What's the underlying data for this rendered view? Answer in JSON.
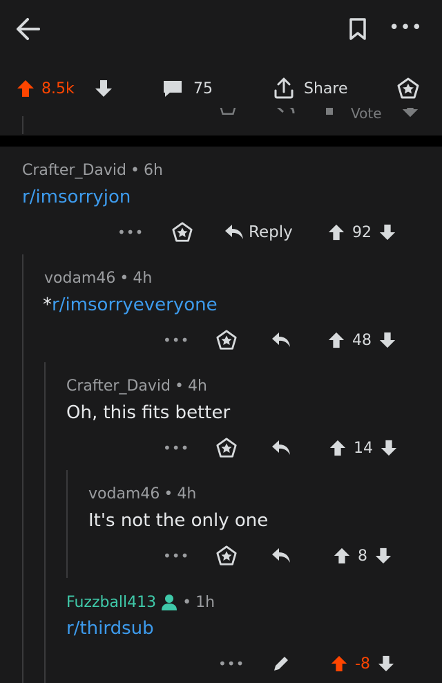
{
  "topbar": {
    "back_icon": "arrow-left-icon",
    "bookmark_icon": "bookmark-icon",
    "more_label": "•••"
  },
  "post_actions": {
    "score": "8.5k",
    "comments": "75",
    "share_label": "Share"
  },
  "ghost": {
    "vote_text": "Vote"
  },
  "colors": {
    "background": "#1a1a1b",
    "upvote": "#ff4500",
    "link": "#3d9bed",
    "mod": "#3fc9a9",
    "meta": "#9b9da0"
  },
  "comments": [
    {
      "author": "Crafter_David",
      "age": "6h",
      "body": "r/imsorryjon",
      "reply_label": "Reply",
      "score": "92"
    },
    {
      "author": "vodam46",
      "age": "4h",
      "body_prefix": "*",
      "body": "r/imsorryeveryone",
      "score": "48"
    },
    {
      "author": "Crafter_David",
      "age": "4h",
      "body": "Oh, this fits better",
      "score": "14"
    },
    {
      "author": "vodam46",
      "age": "4h",
      "body": "It's not the only one",
      "score": "8"
    },
    {
      "author": "Fuzzball413",
      "age": "1h",
      "body": "r/thirdsub",
      "score": "-8"
    }
  ],
  "more_label": "•••",
  "dot": "•"
}
